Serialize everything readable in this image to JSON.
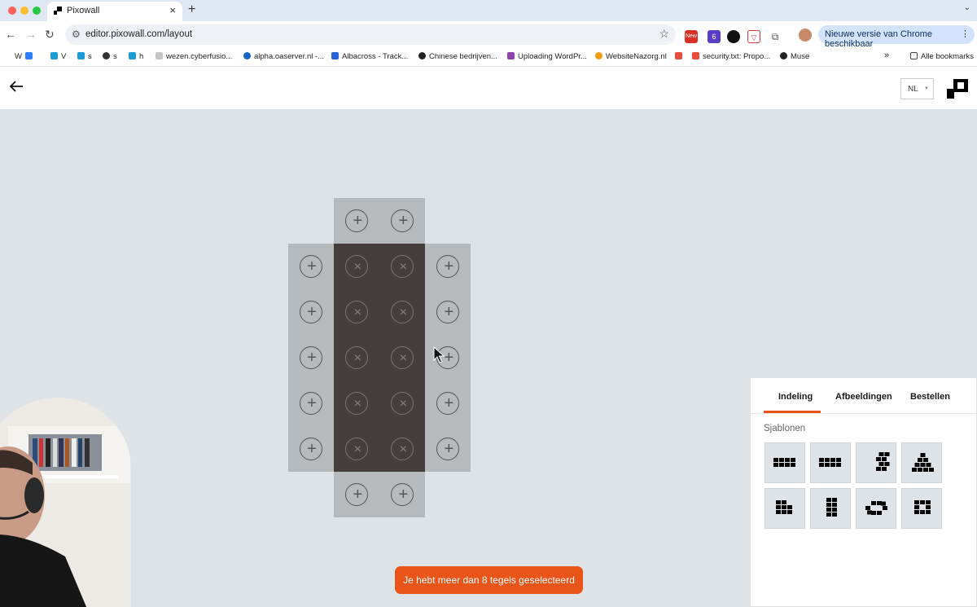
{
  "browser": {
    "tab_title": "Pixowall",
    "tab_close": "×",
    "new_tab": "+",
    "url": "editor.pixowall.com/layout",
    "update_label": "Nieuwe versie van Chrome beschikbaar",
    "ext_new_badge": "New",
    "ext_count_badge": "6",
    "bookmarks": [
      {
        "label": "W"
      },
      {
        "label": "V"
      },
      {
        "label": "s"
      },
      {
        "label": "s"
      },
      {
        "label": "h"
      },
      {
        "label": "wezen.cyberfusio..."
      },
      {
        "label": "alpha.oaserver.nl -..."
      },
      {
        "label": "Albacross - Track..."
      },
      {
        "label": "Chinese bedrijven..."
      },
      {
        "label": "Uploading WordPr..."
      },
      {
        "label": "WebsiteNazorg.nl"
      },
      {
        "label": "security.txt: Propo..."
      },
      {
        "label": "Muse"
      }
    ],
    "bookmarks_overflow": "»",
    "all_bookmarks": "Alle bookmarks"
  },
  "app": {
    "language": "NL",
    "toast": "Je hebt meer dan 8 tegels geselecteerd",
    "panel": {
      "tabs": [
        "Indeling",
        "Afbeeldingen",
        "Bestellen"
      ],
      "active_tab": "Indeling",
      "section_title": "Sjablonen",
      "templates": [
        {
          "name": "row-4x2"
        },
        {
          "name": "row-4x2-alt"
        },
        {
          "name": "zigzag"
        },
        {
          "name": "pyramid"
        },
        {
          "name": "block-3x3"
        },
        {
          "name": "column-2x4"
        },
        {
          "name": "ring"
        },
        {
          "name": "square-2x3"
        }
      ]
    },
    "accent_color": "#e95419",
    "tile_grid": {
      "add_symbol": "+",
      "remove_symbol": "×",
      "rows": [
        [
          "none",
          "add",
          "add",
          "none"
        ],
        [
          "add",
          "remove",
          "remove",
          "add"
        ],
        [
          "add",
          "remove",
          "remove",
          "add"
        ],
        [
          "add",
          "remove",
          "remove",
          "add"
        ],
        [
          "add",
          "remove",
          "remove",
          "add"
        ],
        [
          "add",
          "remove",
          "remove",
          "add"
        ],
        [
          "none",
          "add",
          "add",
          "none"
        ]
      ]
    }
  }
}
